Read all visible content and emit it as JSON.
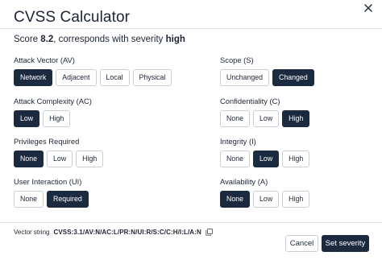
{
  "dialog": {
    "title": "CVSS Calculator",
    "close_icon": "close-icon"
  },
  "score": {
    "prefix": "Score",
    "value": "8.2",
    "middle": ", corresponds with severity",
    "severity": "high"
  },
  "metrics": {
    "attack_vector": {
      "label": "Attack Vector (AV)",
      "options": [
        "Network",
        "Adjacent",
        "Local",
        "Physical"
      ],
      "selected": "Network"
    },
    "attack_complexity": {
      "label": "Attack Complexity (AC)",
      "options": [
        "Low",
        "High"
      ],
      "selected": "Low"
    },
    "privileges_required": {
      "label": "Privileges Required",
      "options": [
        "None",
        "Low",
        "High"
      ],
      "selected": "None"
    },
    "user_interaction": {
      "label": "User Interaction (UI)",
      "options": [
        "None",
        "Required"
      ],
      "selected": "Required"
    },
    "scope": {
      "label": "Scope (S)",
      "options": [
        "Unchanged",
        "Changed"
      ],
      "selected": "Changed"
    },
    "confidentiality": {
      "label": "Confidentiality (C)",
      "options": [
        "None",
        "Low",
        "High"
      ],
      "selected": "High"
    },
    "integrity": {
      "label": "Integrity (I)",
      "options": [
        "None",
        "Low",
        "High"
      ],
      "selected": "Low"
    },
    "availability": {
      "label": "Availability (A)",
      "options": [
        "None",
        "Low",
        "High"
      ],
      "selected": "None"
    }
  },
  "vector": {
    "label": "Vector string",
    "value": "CVSS:3.1/AV:N/AC:L/PR:N/UI:R/S:C/C:H/I:L/A:N",
    "copy_icon": "copy-icon"
  },
  "footer": {
    "cancel_label": "Cancel",
    "submit_label": "Set severity"
  },
  "colors": {
    "selected_bg": "#1c2a40",
    "border": "#c9cfd6",
    "text": "#1c2533"
  }
}
